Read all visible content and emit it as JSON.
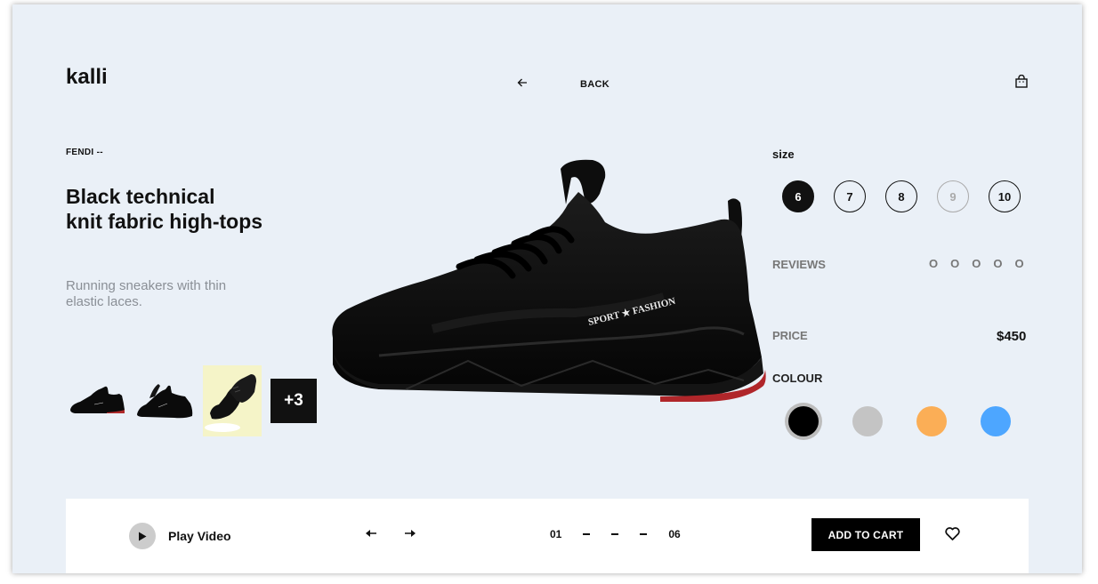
{
  "brand": "kalli",
  "header": {
    "back_label": "BACK"
  },
  "product": {
    "designer": "FENDI --",
    "title_line1": "Black technical",
    "title_line2": "knit fabric high-tops",
    "description": "Running sneakers with thin elastic laces.",
    "more_images": "+3"
  },
  "size": {
    "heading": "size",
    "options": [
      "6",
      "7",
      "8",
      "9",
      "10"
    ],
    "selected": "6",
    "unavailable": [
      "9"
    ]
  },
  "reviews": {
    "heading": "REVIEWS",
    "stars": [
      "O",
      "O",
      "O",
      "O",
      "O"
    ]
  },
  "price": {
    "heading": "PRICE",
    "value": "$450"
  },
  "colour": {
    "heading": "COLOUR",
    "options": [
      "#000000",
      "#c4c4c4",
      "#fbae56",
      "#4da6ff"
    ],
    "selected": "#000000"
  },
  "hero": {
    "brand_text": "SPORT ★ FASHION"
  },
  "bottom": {
    "play_label": "Play Video",
    "page_current": "01",
    "page_total": "06",
    "add_to_cart": "ADD TO CART"
  },
  "icons": {
    "back": "arrow-left-icon",
    "bag": "shopping-bag-icon",
    "play": "play-icon",
    "prev": "arrow-left-icon",
    "next": "arrow-right-icon",
    "wishlist": "heart-icon"
  }
}
